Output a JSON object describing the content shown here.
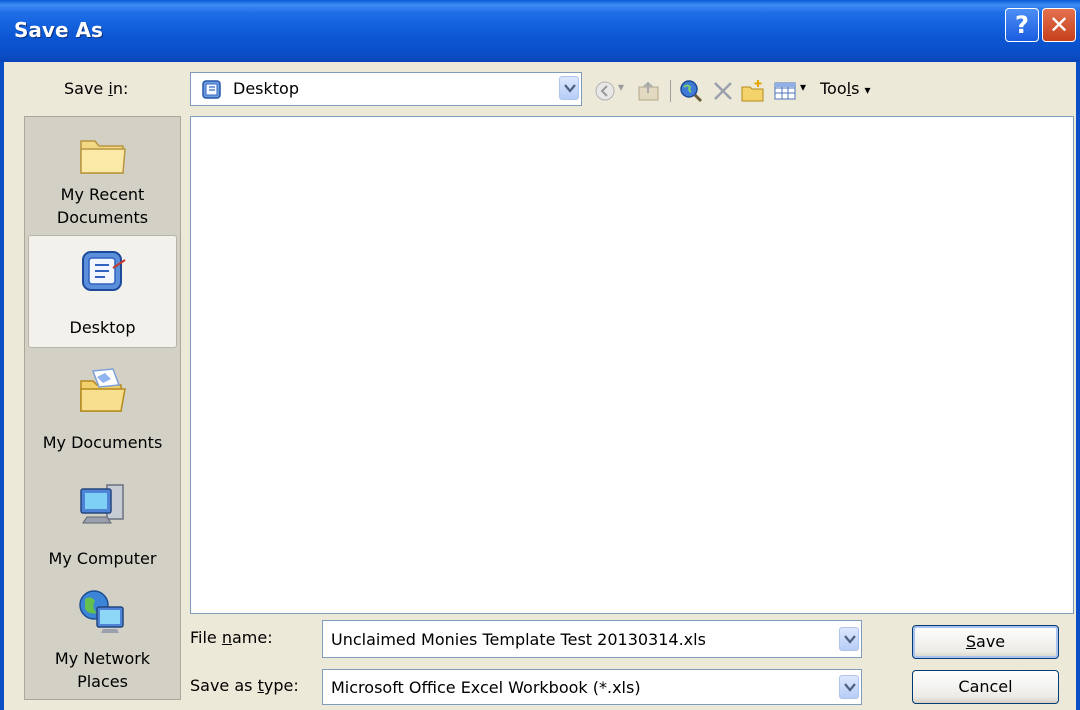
{
  "window": {
    "title": "Save As"
  },
  "title_buttons": {
    "help": "?",
    "close": "✕"
  },
  "save_in": {
    "label_pre": "Save ",
    "label_ul": "i",
    "label_post": "n:",
    "value": "Desktop"
  },
  "toolbar": {
    "tools_pre": "Too",
    "tools_ul": "l",
    "tools_post": "s",
    "tools_arrow": "▾",
    "views_arrow": "▾",
    "back_arrow": "▾"
  },
  "places": [
    {
      "line1": "My Recent",
      "line2": "Documents",
      "icon": "recent-folder-icon"
    },
    {
      "line1": "Desktop",
      "line2": "",
      "icon": "desktop-icon",
      "selected": true
    },
    {
      "line1": "My Documents",
      "line2": "",
      "icon": "my-documents-icon"
    },
    {
      "line1": "My Computer",
      "line2": "",
      "icon": "my-computer-icon"
    },
    {
      "line1": "My Network",
      "line2": "Places",
      "icon": "network-places-icon"
    }
  ],
  "file_name": {
    "label_pre": "File ",
    "label_ul": "n",
    "label_post": "ame:",
    "value": "Unclaimed Monies Template Test 20130314.xls"
  },
  "save_type": {
    "label_pre": "Save as ",
    "label_ul": "t",
    "label_post": "ype:",
    "value": "Microsoft Office Excel Workbook (*.xls)"
  },
  "buttons": {
    "save_ul": "S",
    "save_post": "ave",
    "cancel": "Cancel"
  },
  "colors": {
    "title_bar": "#0a4fc8",
    "dialog_bg": "#ece9d8",
    "sidebar_bg": "#d3d0c5"
  }
}
